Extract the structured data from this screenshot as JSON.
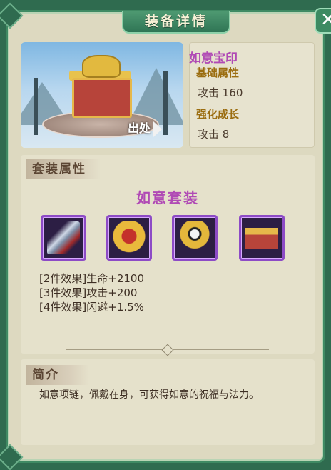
{
  "window": {
    "title": "装备详情",
    "close_icon": "close-icon"
  },
  "item": {
    "name": "如意宝印",
    "source_label": "出处",
    "base_attr_header": "基础属性",
    "base_attr": "攻击 160",
    "growth_header": "强化成长",
    "growth_attr": "攻击 8"
  },
  "set_section": {
    "tab_label": "套装属性",
    "set_name": "如意套装",
    "pieces": [
      "sword-icon",
      "gold-armor-icon",
      "yinyang-crown-icon",
      "treasure-box-icon"
    ],
    "effects": [
      "[2件效果]生命+2100",
      "[3件效果]攻击+200",
      "[4件效果]闪避+1.5%"
    ]
  },
  "intro_section": {
    "tab_label": "简介",
    "text": "如意项链，佩戴在身，可获得如意的祝福与法力。"
  },
  "colors": {
    "accent_purple": "#b04ab5",
    "frame_green": "#3f8a63",
    "panel_bg": "#ddd9c0"
  }
}
